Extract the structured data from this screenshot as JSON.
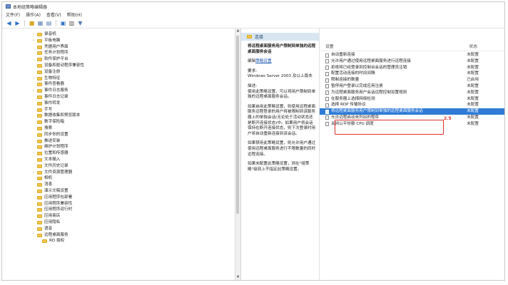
{
  "window": {
    "title": "本地组策略编辑器"
  },
  "menu": [
    "文件(F)",
    "操作(A)",
    "查看(V)",
    "帮助(H)"
  ],
  "toolbar": {
    "icons": [
      "back-arrow-icon",
      "forward-arrow-icon",
      "folder-up-icon",
      "show-hide-tree-icon",
      "export-list-icon",
      "help-icon",
      "properties-icon",
      "filter-icon"
    ]
  },
  "tree": {
    "items": [
      {
        "label": "录音机",
        "level": 2,
        "expand": ">"
      },
      {
        "label": "平板电脑",
        "level": 2,
        "expand": ">"
      },
      {
        "label": "凭据用户界面",
        "level": 2,
        "expand": ""
      },
      {
        "label": "任务计划程序",
        "level": 2,
        "expand": ""
      },
      {
        "label": "软件保护平台",
        "level": 2,
        "expand": ""
      },
      {
        "label": "设备和驱动程序兼容性",
        "level": 2,
        "expand": ""
      },
      {
        "label": "设备注册",
        "level": 2,
        "expand": ""
      },
      {
        "label": "生物特征",
        "level": 2,
        "expand": ">"
      },
      {
        "label": "事件查看器",
        "level": 2,
        "expand": ""
      },
      {
        "label": "事件日志服务",
        "level": 2,
        "expand": ">"
      },
      {
        "label": "事件日志记录",
        "level": 2,
        "expand": ""
      },
      {
        "label": "事件转发",
        "level": 2,
        "expand": ""
      },
      {
        "label": "手写",
        "level": 2,
        "expand": ""
      },
      {
        "label": "数据收集和预览版本",
        "level": 2,
        "expand": ""
      },
      {
        "label": "数字保险箱",
        "level": 2,
        "expand": ""
      },
      {
        "label": "搜索",
        "level": 2,
        "expand": ""
      },
      {
        "label": "同步你的设置",
        "level": 2,
        "expand": ""
      },
      {
        "label": "推送安装",
        "level": 2,
        "expand": ""
      },
      {
        "label": "维护计划程序",
        "level": 2,
        "expand": ""
      },
      {
        "label": "位置和传感器",
        "level": 2,
        "expand": ">"
      },
      {
        "label": "文本输入",
        "level": 2,
        "expand": ""
      },
      {
        "label": "文件历史记录",
        "level": 2,
        "expand": ""
      },
      {
        "label": "文件资源管理器",
        "level": 2,
        "expand": ">"
      },
      {
        "label": "相机",
        "level": 2,
        "expand": ""
      },
      {
        "label": "消息",
        "level": 2,
        "expand": ""
      },
      {
        "label": "演示文稿设置",
        "level": 2,
        "expand": ""
      },
      {
        "label": "应用程序包部署",
        "level": 2,
        "expand": ""
      },
      {
        "label": "应用程序兼容性",
        "level": 2,
        "expand": ""
      },
      {
        "label": "应用程序运行时",
        "level": 2,
        "expand": ""
      },
      {
        "label": "应用商店",
        "level": 2,
        "expand": ""
      },
      {
        "label": "应用隐私",
        "level": 2,
        "expand": ""
      },
      {
        "label": "语音",
        "level": 2,
        "expand": ""
      },
      {
        "label": "远程桌面服务",
        "level": 2,
        "expand": "v"
      },
      {
        "label": "RD 授权",
        "level": 3,
        "expand": ""
      }
    ]
  },
  "description": {
    "header": "连接",
    "policy_title": "将远程桌面服务用户限制到单独的远程桌面服务会话",
    "edit_prefix": "编辑",
    "edit_link": "策略设置",
    "requirement_label": "要求:",
    "requirement_value": "Windows Server 2003 及以上版本",
    "desc_label": "描述:",
    "desc_text": "使用此策略设置，可以将用户限制到单独的远程桌面服务会话。",
    "enabled_text": "如果启用此策略设置，则使用远程桌面服务远程登录的用户将被限制到该服务器上的单独会话(无论处于活动状态还是断开连接状态)中。如果用户将会话保持在断开连接状态，则下次登录时用户将自动重新连接到该会话。",
    "disabled_text": "如果禁用此策略设置，则允许用户通过使用远程桌面服务进行不限数量的同时远程连接。",
    "notconfigured_text": "如果未配置此策略设置，则在\"组策略\"级别上不指定此策略设置。"
  },
  "list": {
    "col_setting": "设置",
    "col_state": "状态",
    "rows": [
      {
        "name": "自动重新连接",
        "state": "未配置"
      },
      {
        "name": "允许用户通过使用远程桌面服务进行远程连接",
        "state": "未配置"
      },
      {
        "name": "拒绝将已经登录到控制台会话的管理员注销",
        "state": "未配置"
      },
      {
        "name": "配置活动连接的时间间隔",
        "state": "未配置"
      },
      {
        "name": "限制连接的数量",
        "state": "已启用"
      },
      {
        "name": "暂停用户登录以完成应用注册",
        "state": "未配置"
      },
      {
        "name": "为远程桌面服务用户会话远程控制设置规则",
        "state": "未配置"
      },
      {
        "name": "在服务器上选择网络检测",
        "state": "未配置"
      },
      {
        "name": "选择 RDP 传输协议",
        "state": "未配置"
      },
      {
        "name": "将远程桌面服务用户限制到单独的远程桌面服务会话",
        "state": "未配置",
        "selected": true
      },
      {
        "name": "允许远程启动未列出的程序",
        "state": "未配置"
      },
      {
        "name": "关闭公平份额 CPU 调度",
        "state": "未配置"
      }
    ]
  },
  "annotation": {
    "mark": "2.5"
  },
  "colors": {
    "selection": "#2f7bd6",
    "highlight_border": "#e0302f",
    "header_bar": "#d9e6f2"
  }
}
